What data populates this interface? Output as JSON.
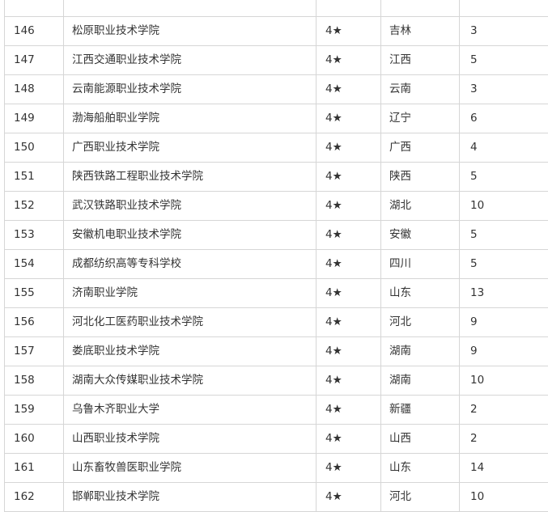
{
  "rows": [
    {
      "rank": "146",
      "name": "松原职业技术学院",
      "star": "4★",
      "province": "吉林",
      "count": "3"
    },
    {
      "rank": "147",
      "name": "江西交通职业技术学院",
      "star": "4★",
      "province": "江西",
      "count": "5"
    },
    {
      "rank": "148",
      "name": "云南能源职业技术学院",
      "star": "4★",
      "province": "云南",
      "count": "3"
    },
    {
      "rank": "149",
      "name": "渤海船舶职业学院",
      "star": "4★",
      "province": "辽宁",
      "count": "6"
    },
    {
      "rank": "150",
      "name": "广西职业技术学院",
      "star": "4★",
      "province": "广西",
      "count": "4"
    },
    {
      "rank": "151",
      "name": "陕西铁路工程职业技术学院",
      "star": "4★",
      "province": "陕西",
      "count": "5"
    },
    {
      "rank": "152",
      "name": "武汉铁路职业技术学院",
      "star": "4★",
      "province": "湖北",
      "count": "10"
    },
    {
      "rank": "153",
      "name": "安徽机电职业技术学院",
      "star": "4★",
      "province": "安徽",
      "count": "5"
    },
    {
      "rank": "154",
      "name": "成都纺织高等专科学校",
      "star": "4★",
      "province": "四川",
      "count": "5"
    },
    {
      "rank": "155",
      "name": "济南职业学院",
      "star": "4★",
      "province": "山东",
      "count": "13"
    },
    {
      "rank": "156",
      "name": "河北化工医药职业技术学院",
      "star": "4★",
      "province": "河北",
      "count": "9"
    },
    {
      "rank": "157",
      "name": "娄底职业技术学院",
      "star": "4★",
      "province": "湖南",
      "count": "9"
    },
    {
      "rank": "158",
      "name": "湖南大众传媒职业技术学院",
      "star": "4★",
      "province": "湖南",
      "count": "10"
    },
    {
      "rank": "159",
      "name": "乌鲁木齐职业大学",
      "star": "4★",
      "province": "新疆",
      "count": "2"
    },
    {
      "rank": "160",
      "name": "山西职业技术学院",
      "star": "4★",
      "province": "山西",
      "count": "2"
    },
    {
      "rank": "161",
      "name": "山东畜牧兽医职业学院",
      "star": "4★",
      "province": "山东",
      "count": "14"
    },
    {
      "rank": "162",
      "name": "邯郸职业技术学院",
      "star": "4★",
      "province": "河北",
      "count": "10"
    }
  ]
}
